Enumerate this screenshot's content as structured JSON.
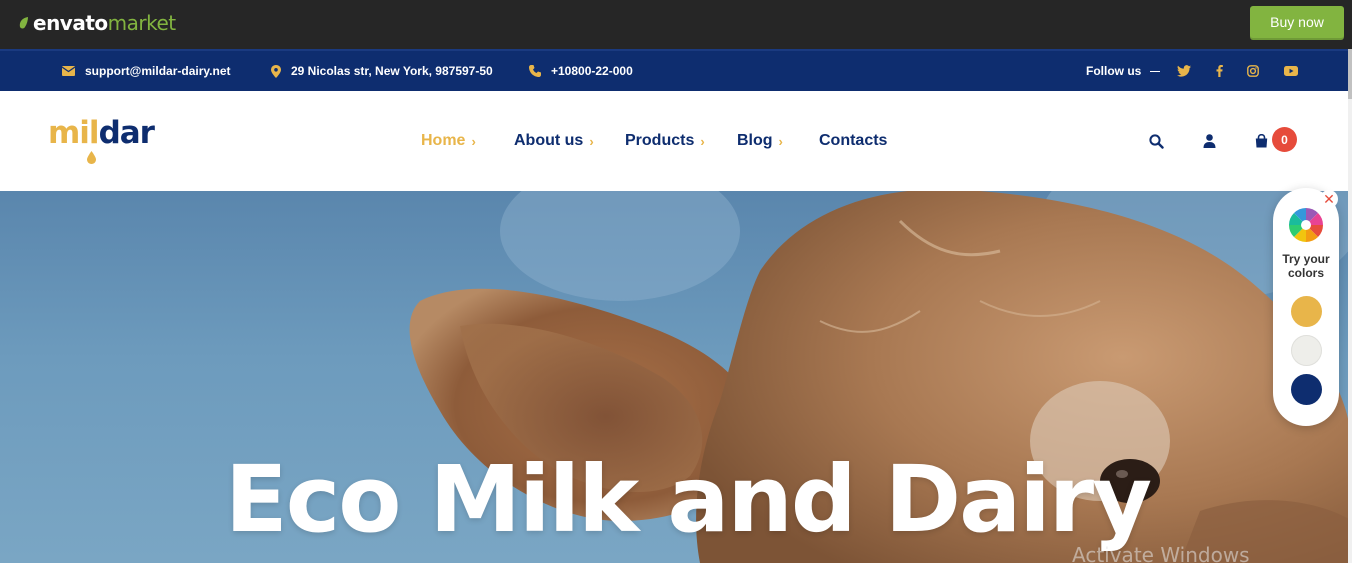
{
  "envato": {
    "word": "envato",
    "market": "market",
    "buy_now": "Buy now"
  },
  "topbar": {
    "email": "support@mildar-dairy.net",
    "address": "29 Nicolas str, New York, 987597-50",
    "phone": "+10800-22-000",
    "follow_us": "Follow us",
    "socials": [
      "twitter-icon",
      "facebook-icon",
      "instagram-icon",
      "youtube-icon"
    ]
  },
  "header": {
    "logo_part1": "mil",
    "logo_part2": "dar",
    "nav": [
      {
        "label": "Home",
        "active": true
      },
      {
        "label": "About us"
      },
      {
        "label": "Products"
      },
      {
        "label": "Blog"
      },
      {
        "label": "Contacts"
      }
    ],
    "cart_count": "0"
  },
  "hero": {
    "title": "Eco Milk and Dairy",
    "watermark": "Activate Windows"
  },
  "color_panel": {
    "label": "Try your colors",
    "swatches": [
      "#e8b54a",
      "#eeeeea",
      "#0e2d6f"
    ]
  },
  "colors": {
    "navy": "#0e2d6f",
    "gold": "#e8b54a",
    "green": "#82b440",
    "badge": "#e64b3b"
  }
}
